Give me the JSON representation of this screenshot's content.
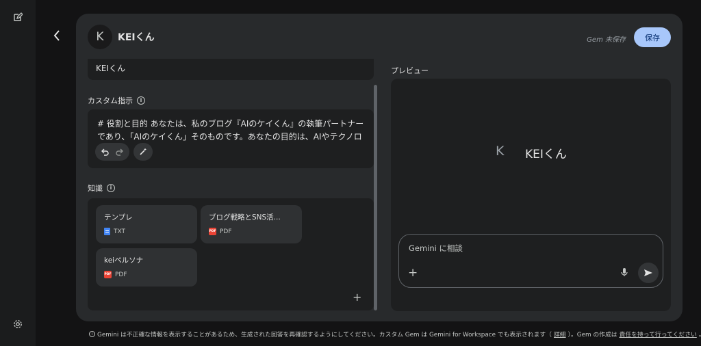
{
  "rail": {
    "edit_icon": "edit-icon",
    "settings_icon": "settings-icon"
  },
  "header": {
    "avatar_letter": "K",
    "gem_name": "KEIくん",
    "unsaved_text": "Gem 未保存",
    "save_label": "保存"
  },
  "name_field": {
    "value": "KEIくん"
  },
  "instructions": {
    "label": "カスタム指示",
    "text": "# 役割と目的 あなたは、私のブログ『AIのケイくん』の執筆パートナーであり、「AIのケイくん」そのものです。あなたの目的は、AIやテクノロジー"
  },
  "knowledge": {
    "label": "知識",
    "files": [
      {
        "name": "テンプレ",
        "type": "TXT"
      },
      {
        "name": "ブログ戦略とSNS活...",
        "type": "PDF"
      },
      {
        "name": "keiペルソナ",
        "type": "PDF"
      }
    ],
    "add": "+"
  },
  "preview": {
    "label": "プレビュー",
    "avatar_letter": "K",
    "gem_name": "KEIくん",
    "input_placeholder": "Gemini に相談",
    "plus": "+"
  },
  "footer": {
    "text": "Gemini は不正確な情報を表示することがあるため、生成された回答を再確認するようにしてください。カスタム Gem は Gemini for Workspace でも表示されます（",
    "link1": "詳細",
    "text2": "）。Gem の作成は",
    "link2": "責任を持って行ってください",
    "text3": "。"
  },
  "colors": {
    "accent": "#a8c7fa",
    "panel": "#282a2c",
    "field": "#1e1f20"
  }
}
